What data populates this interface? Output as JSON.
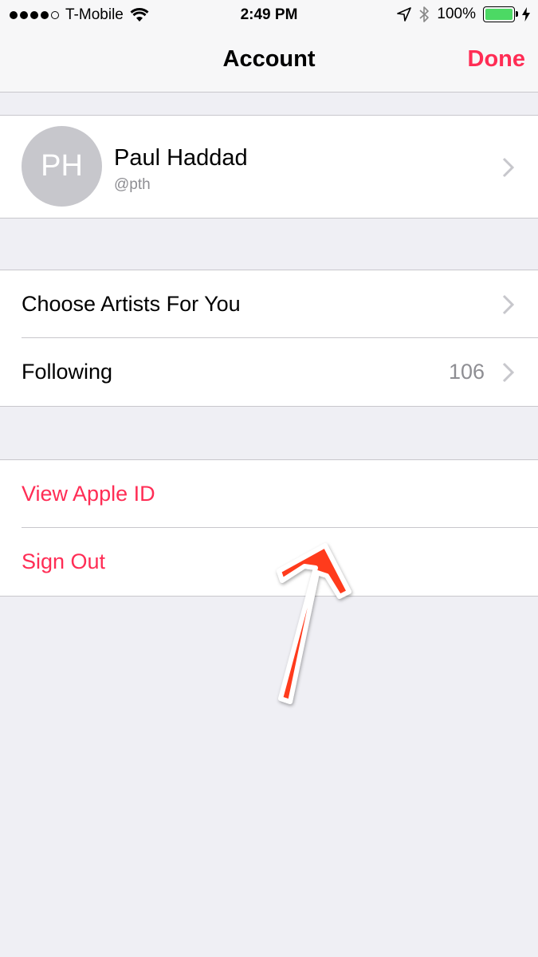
{
  "status_bar": {
    "carrier": "T-Mobile",
    "time": "2:49 PM",
    "battery": "100%"
  },
  "nav": {
    "title": "Account",
    "done": "Done"
  },
  "profile": {
    "initials": "PH",
    "name": "Paul Haddad",
    "handle": "@pth"
  },
  "menu": {
    "choose_artists": "Choose Artists For You",
    "following_label": "Following",
    "following_count": "106",
    "view_apple_id": "View Apple ID",
    "sign_out": "Sign Out"
  },
  "colors": {
    "accent": "#ff2d55",
    "annotation_arrow": "#ff3b1f"
  }
}
